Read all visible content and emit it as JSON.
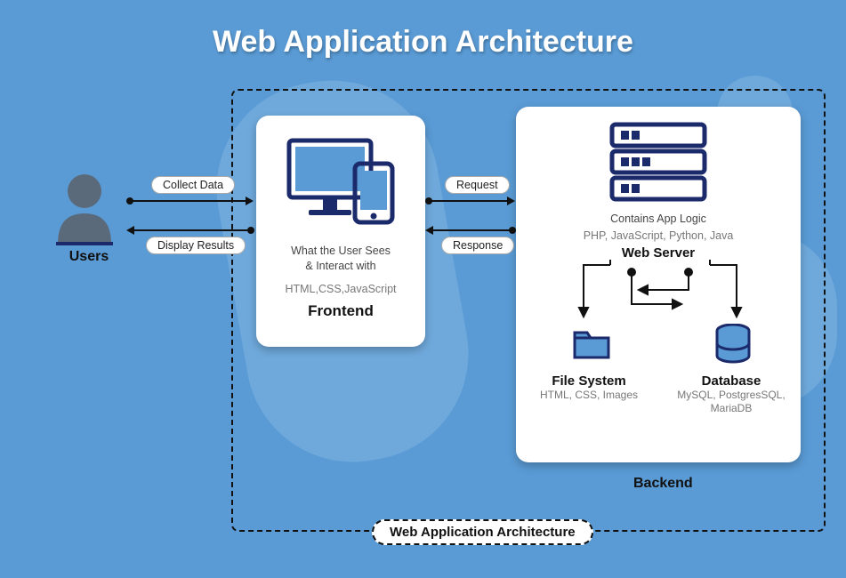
{
  "title": "Web Application Architecture",
  "users_label": "Users",
  "arrows_user_frontend": {
    "top": "Collect Data",
    "bottom": "Display Results"
  },
  "arrows_frontend_backend": {
    "top": "Request",
    "bottom": "Response"
  },
  "frontend": {
    "desc_line1": "What the User Sees",
    "desc_line2": "& Interact with",
    "tech": "HTML,CSS,JavaScript",
    "label": "Frontend"
  },
  "backend": {
    "desc": "Contains App Logic",
    "tech": "PHP, JavaScript, Python, Java",
    "webserver_label": "Web Server",
    "filesystem": {
      "label": "File System",
      "tech": "HTML, CSS, Images"
    },
    "database": {
      "label": "Database",
      "tech": "MySQL, PostgresSQL, MariaDB"
    },
    "label": "Backend"
  },
  "architecture_label": "Web Application Architecture"
}
